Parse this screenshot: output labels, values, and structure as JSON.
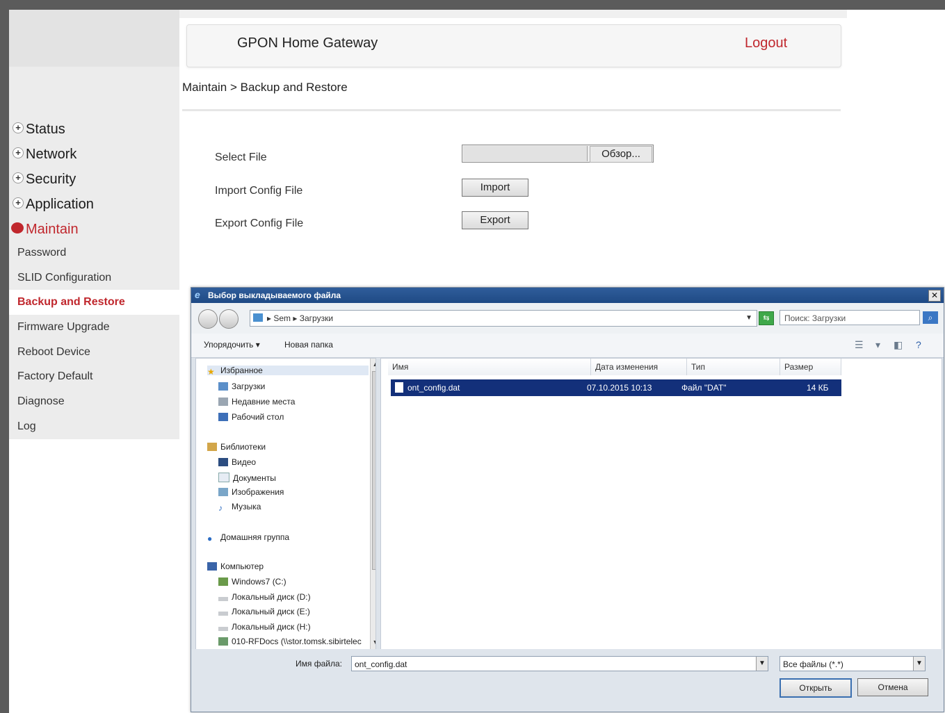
{
  "header": {
    "title": "GPON Home Gateway",
    "logout": "Logout"
  },
  "breadcrumb": "Maintain > Backup and Restore",
  "menu": [
    {
      "label": "Status",
      "active": false
    },
    {
      "label": "Network",
      "active": false
    },
    {
      "label": "Security",
      "active": false
    },
    {
      "label": "Application",
      "active": false
    },
    {
      "label": "Maintain",
      "active": true
    }
  ],
  "submenu": [
    {
      "label": "Password"
    },
    {
      "label": "SLID Configuration"
    },
    {
      "label": "Backup and Restore",
      "selected": true
    },
    {
      "label": "Firmware Upgrade"
    },
    {
      "label": "Reboot Device"
    },
    {
      "label": "Factory Default"
    },
    {
      "label": "Diagnose"
    },
    {
      "label": "Log"
    }
  ],
  "form": {
    "select_file_label": "Select File",
    "browse_label": "Обзор...",
    "import_label": "Import Config File",
    "import_button": "Import",
    "export_label": "Export Config File",
    "export_button": "Export"
  },
  "dialog": {
    "title": "Выбор выкладываемого файла",
    "address": {
      "parts": [
        "Sem",
        "Загрузки"
      ]
    },
    "search_placeholder": "Поиск: Загрузки",
    "toolbar": {
      "organize": "Упорядочить ▾",
      "new_folder": "Новая папка"
    },
    "nav": {
      "favorites": "Избранное",
      "favorites_items": [
        "Загрузки",
        "Недавние места",
        "Рабочий стол"
      ],
      "libraries": "Библиотеки",
      "libraries_items": [
        "Видео",
        "Документы",
        "Изображения",
        "Музыка"
      ],
      "homegroup": "Домашняя группа",
      "computer": "Компьютер",
      "computer_items": [
        "Windows7 (C:)",
        "Локальный диск (D:)",
        "Локальный диск (E:)",
        "Локальный диск (H:)",
        "010-RFDocs (\\\\stor.tomsk.sibirtelec"
      ]
    },
    "columns": {
      "name": "Имя",
      "date": "Дата изменения",
      "type": "Тип",
      "size": "Размер"
    },
    "files": [
      {
        "name": "ont_config.dat",
        "date": "07.10.2015 10:13",
        "type": "Файл \"DAT\"",
        "size": "14 КБ"
      }
    ],
    "filename_label": "Имя файла:",
    "filename_value": "ont_config.dat",
    "filetype_value": "Все файлы (*.*)",
    "open_button": "Открыть",
    "cancel_button": "Отмена"
  }
}
